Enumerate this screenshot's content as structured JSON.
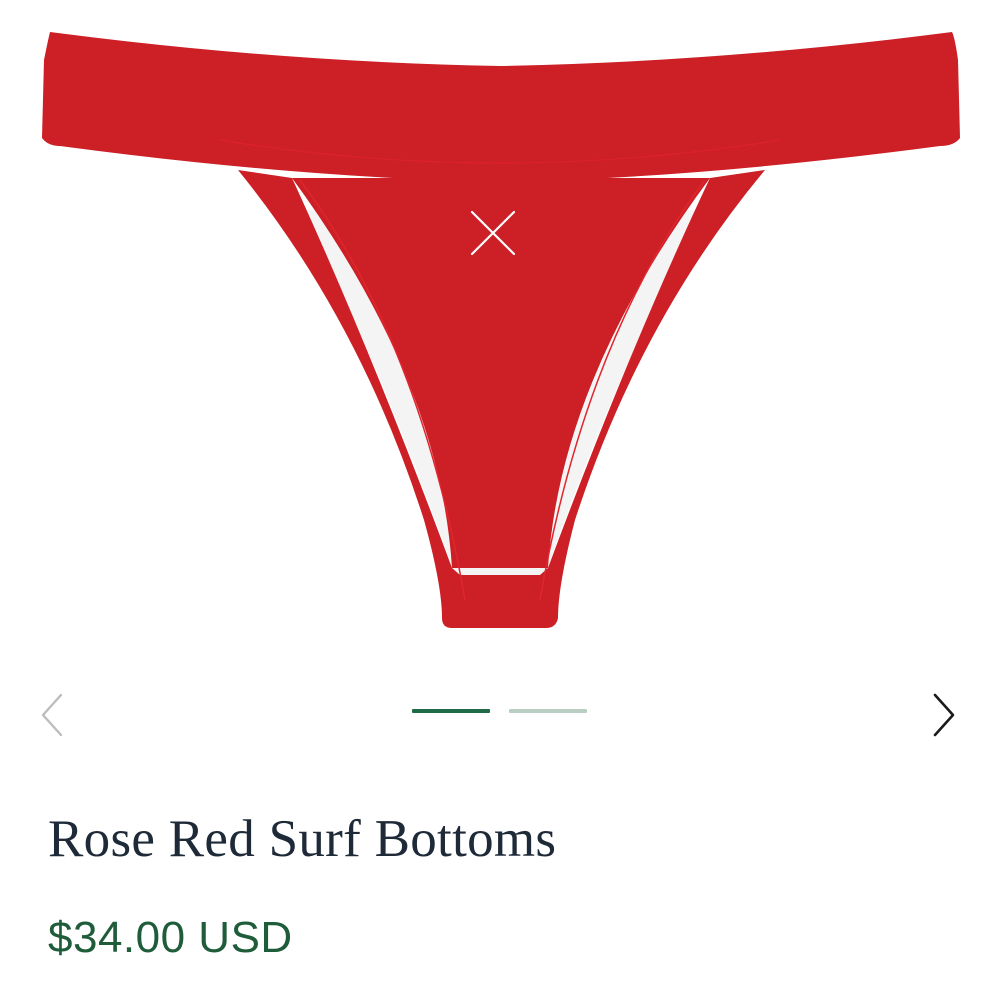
{
  "product": {
    "title": "Rose Red Surf Bottoms",
    "price": "$34.00 USD",
    "image_alt": "Rose Red Surf Bottoms",
    "product_color": "#cc1f26",
    "logo_mark": "X"
  },
  "carousel": {
    "prev_icon": "chevron-left-icon",
    "next_icon": "chevron-right-icon",
    "slide_count": 2,
    "active_index": 0,
    "active_color": "#1f6b47",
    "inactive_color": "#b9cfc4"
  },
  "colors": {
    "title": "#1e2a38",
    "price": "#1f5c3a",
    "prev_arrow": "#bdbdbd",
    "next_arrow": "#1a1a1a"
  }
}
